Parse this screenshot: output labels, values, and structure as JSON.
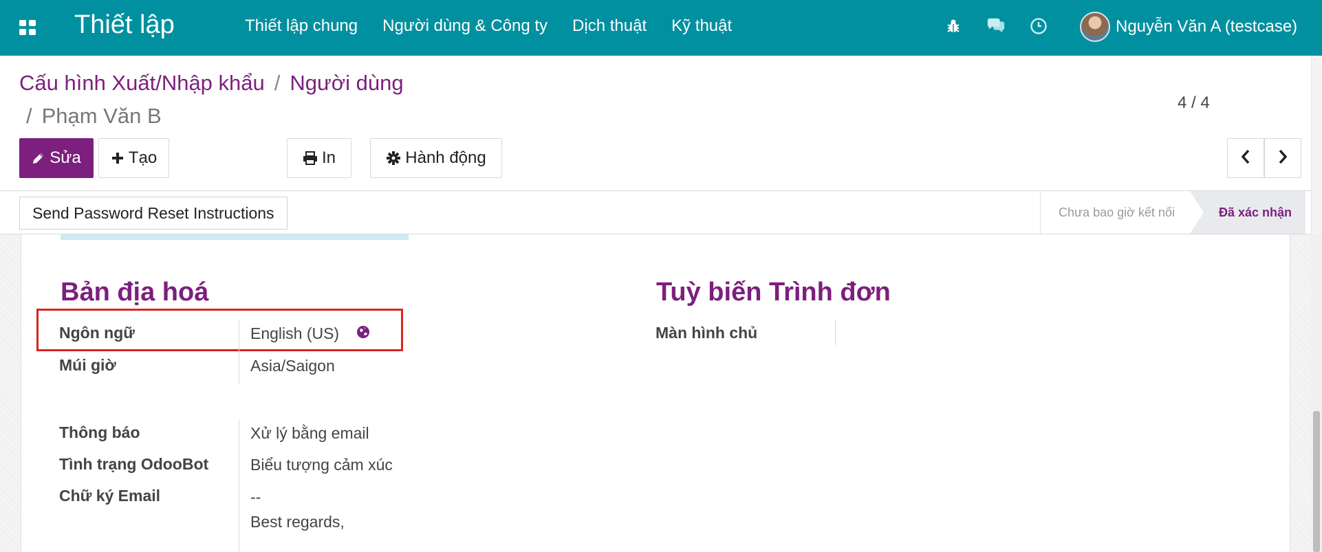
{
  "navbar": {
    "app_title": "Thiết lập",
    "menu": [
      "Thiết lập chung",
      "Người dùng & Công ty",
      "Dịch thuật",
      "Kỹ thuật"
    ],
    "icons": [
      "bug-icon",
      "chat-icon",
      "clock-icon"
    ],
    "user_name": "Nguyễn Văn A (testcase)"
  },
  "breadcrumb": {
    "items": [
      "Cấu hình Xuất/Nhập khẩu",
      "Người dùng"
    ],
    "current": "Phạm Văn B",
    "separator": "/"
  },
  "toolbar": {
    "edit_label": "Sửa",
    "create_label": "Tạo",
    "print_label": "In",
    "action_label": "Hành động"
  },
  "pager": {
    "text": "4 / 4"
  },
  "statusbar": {
    "reset_label": "Send Password Reset Instructions",
    "stages": [
      "Chưa bao giờ kết nối",
      "Đã xác nhận"
    ],
    "active_stage": "Đã xác nhận"
  },
  "localization": {
    "title": "Bản địa hoá",
    "language_label": "Ngôn ngữ",
    "language_value": "English (US)",
    "timezone_label": "Múi giờ",
    "timezone_value": "Asia/Saigon"
  },
  "menu_custom": {
    "title": "Tuỳ biến Trình đơn",
    "home_label": "Màn hình chủ",
    "home_value": ""
  },
  "preferences": {
    "notification_label": "Thông báo",
    "notification_value": "Xử lý bằng email",
    "odoobot_label": "Tình trạng OdooBot",
    "odoobot_value": "Biểu tượng cảm xúc",
    "signature_label": "Chữ ký Email",
    "signature_line1": "--",
    "signature_line2": "Best regards,"
  },
  "colors": {
    "navbar": "#00909f",
    "primary": "#7c1f7e",
    "highlight": "#d9251d"
  }
}
